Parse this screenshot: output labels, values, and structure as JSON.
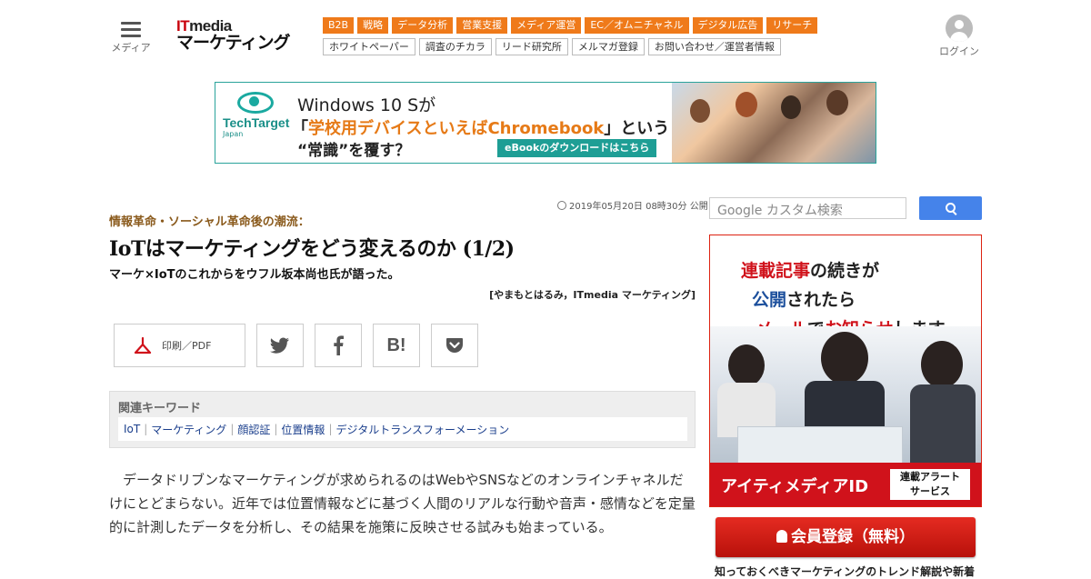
{
  "header": {
    "menu_label": "メディア",
    "logo_itmedia": [
      "I",
      "T",
      "media"
    ],
    "logo_sub": "マーケティング",
    "categories": [
      "B2B",
      "戦略",
      "データ分析",
      "営業支援",
      "メディア運営",
      "EC／オムニチャネル",
      "デジタル広告",
      "リサーチ"
    ],
    "sublinks": [
      "ホワイトペーパー",
      "調査のチカラ",
      "リード研究所",
      "メルマガ登録",
      "お問い合わせ／運営者情報"
    ],
    "login_label": "ログイン"
  },
  "banner": {
    "brand": "TechTarget",
    "brand_sub": "Japan",
    "line1": "Windows 10 Sが",
    "line2_pre": "「",
    "line2_hl": "学校用デバイスといえばChromebook",
    "line2_post": "」という",
    "line3": "“常識”を覆す？",
    "cta": "eBookのダウンロードはこちら"
  },
  "article": {
    "date": "2019年05月20日 08時30分 公開",
    "kicker": "情報革命・ソーシャル革命後の潮流：",
    "title": "IoTはマーケティングをどう変えるのか (1/2)",
    "subtitle": "マーケ×IoTのこれからをウフル坂本尚也氏が語った。",
    "author": "[やまもとはるみ，ITmedia マーケティング]",
    "print_label": "印刷／PDF",
    "keywords_heading": "関連キーワード",
    "keywords": [
      "IoT",
      "マーケティング",
      "顔認証",
      "位置情報",
      "デジタルトランスフォーメーション"
    ],
    "body": "データドリブンなマーケティングが求められるのはWebやSNSなどのオンラインチャネルだけにとどまらない。近年では位置情報などに基づく人間のリアルな行動や音声・感情などを定量的に計測したデータを分析し、その結果を施策に反映させる試みも始まっている。"
  },
  "sidebar": {
    "search_placeholder": "Google カスタム検索",
    "ad": {
      "l1_a": "連載記事",
      "l1_b": "の続きが",
      "l2_a": "公開",
      "l2_b": "されたら",
      "l3_a": "メール",
      "l3_b": "で",
      "l3_c": "お知らせ",
      "l3_d": "します",
      "brand": "アイティメディアID",
      "tag_l1": "連載アラート",
      "tag_l2": "サービス"
    },
    "register_label": "会員登録（無料）",
    "caption": "知っておくべきマーケティングのトレンド解説や新着"
  },
  "colors": {
    "category_orange": "#ef7a1a",
    "brand_red": "#c8000b",
    "techtarget_teal": "#1aa9a0",
    "ad_red": "#d0121b",
    "search_blue": "#4583ea"
  }
}
